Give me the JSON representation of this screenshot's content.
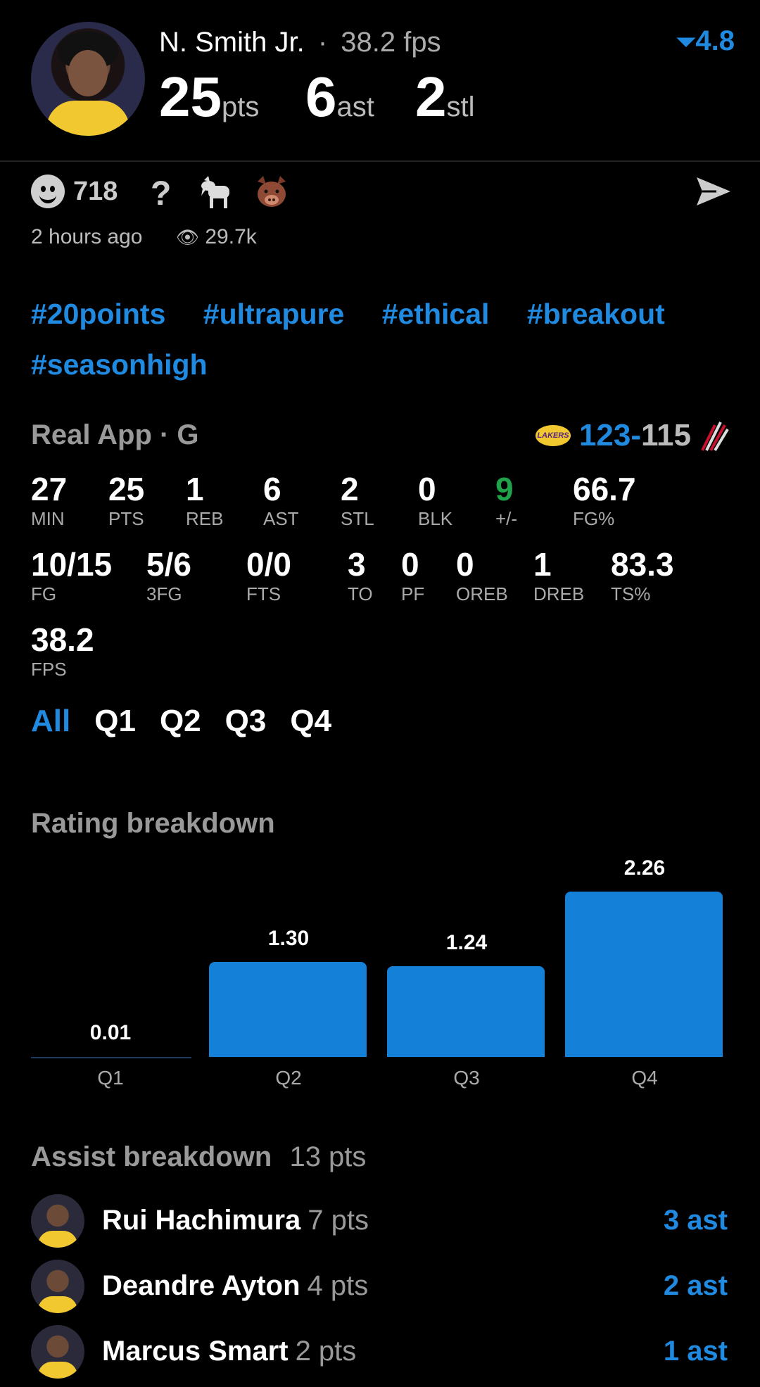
{
  "header": {
    "player_name": "N. Smith Jr.",
    "separator": "·",
    "fps_text": "38.2 fps",
    "rating": "4.8",
    "pts": "25",
    "pts_unit": "pts",
    "ast": "6",
    "ast_unit": "ast",
    "stl": "2",
    "stl_unit": "stl"
  },
  "reactions": {
    "smiley_count": "718",
    "question": "?"
  },
  "meta": {
    "time": "2 hours ago",
    "views": "29.7k"
  },
  "tags": [
    "#20points",
    "#ultrapure",
    "#ethical",
    "#breakout",
    "#seasonhigh"
  ],
  "game": {
    "source": "Real App · G",
    "team_logo_text": "LAKERS",
    "score_own": "123",
    "score_dash": "-",
    "score_opp": "115"
  },
  "stats_row1": [
    {
      "value": "27",
      "label": "MIN"
    },
    {
      "value": "25",
      "label": "PTS"
    },
    {
      "value": "1",
      "label": "REB"
    },
    {
      "value": "6",
      "label": "AST"
    },
    {
      "value": "2",
      "label": "STL"
    },
    {
      "value": "0",
      "label": "BLK"
    },
    {
      "value": "9",
      "label": "+/-",
      "color": "#1fa24a"
    },
    {
      "value": "66.7",
      "label": "FG%"
    }
  ],
  "stats_row2": [
    {
      "value": "10/15",
      "label": "FG"
    },
    {
      "value": "5/6",
      "label": "3FG"
    },
    {
      "value": "0/0",
      "label": "FTS"
    },
    {
      "value": "3",
      "label": "TO"
    },
    {
      "value": "0",
      "label": "PF"
    },
    {
      "value": "0",
      "label": "OREB"
    },
    {
      "value": "1",
      "label": "DREB"
    },
    {
      "value": "83.3",
      "label": "TS%"
    }
  ],
  "stats_row3": [
    {
      "value": "38.2",
      "label": "FPS"
    }
  ],
  "quarter_tabs": [
    "All",
    "Q1",
    "Q2",
    "Q3",
    "Q4"
  ],
  "rating_section": {
    "title": "Rating breakdown"
  },
  "chart_data": {
    "type": "bar",
    "categories": [
      "Q1",
      "Q2",
      "Q3",
      "Q4"
    ],
    "values": [
      0.01,
      1.3,
      1.24,
      2.26
    ],
    "value_labels": [
      "0.01",
      "1.30",
      "1.24",
      "2.26"
    ],
    "title": "Rating breakdown",
    "xlabel": "",
    "ylabel": "",
    "ylim": [
      0,
      2.26
    ],
    "color": "#1480d8"
  },
  "assist_section": {
    "title": "Assist breakdown",
    "total": "13 pts"
  },
  "assists": [
    {
      "name": "Rui Hachimura",
      "pts": "7 pts",
      "ast": "3 ast"
    },
    {
      "name": "Deandre Ayton",
      "pts": "4 pts",
      "ast": "2 ast"
    },
    {
      "name": "Marcus Smart",
      "pts": "2 pts",
      "ast": "1 ast"
    }
  ],
  "colors": {
    "accent": "#1f8ae0",
    "positive": "#1fa24a",
    "background": "#000000"
  }
}
